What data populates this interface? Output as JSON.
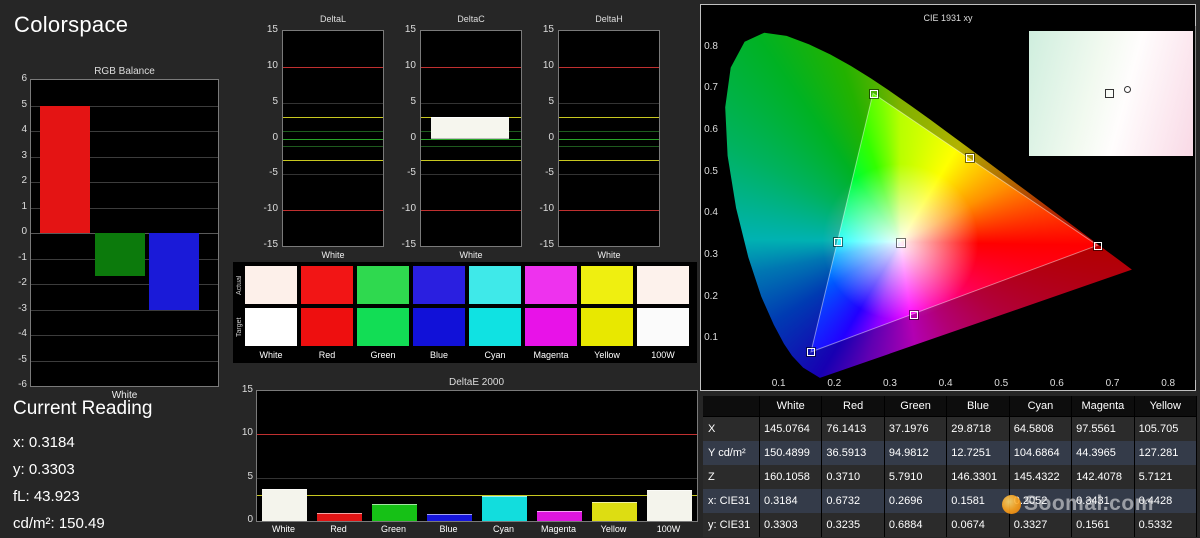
{
  "app": {
    "title": "Colorspace"
  },
  "current_reading": {
    "heading": "Current Reading",
    "lines": [
      {
        "label": "x:",
        "value": "0.3184"
      },
      {
        "label": "y:",
        "value": "0.3303"
      },
      {
        "label": "fL:",
        "value": "43.923"
      },
      {
        "label": "cd/m²:",
        "value": "150.49"
      }
    ]
  },
  "watermark": {
    "text": "Soomal.com"
  },
  "swatches": {
    "row_labels": [
      "Actual",
      "Target"
    ],
    "columns": [
      "White",
      "Red",
      "Green",
      "Blue",
      "Cyan",
      "Magenta",
      "Yellow",
      "100W"
    ],
    "actual_colors": [
      "#fdf0ea",
      "#f21515",
      "#2fd94f",
      "#2a1fe0",
      "#3fe9e9",
      "#ee32ee",
      "#efef10",
      "#fdf2ec"
    ],
    "target_colors": [
      "#ffffff",
      "#ee0f0f",
      "#12dd55",
      "#1111d8",
      "#10e2e2",
      "#e812e8",
      "#e8e800",
      "#fbfbfb"
    ]
  },
  "chart_data": [
    {
      "id": "rgb_balance",
      "type": "bar",
      "title": "RGB Balance",
      "xlabel": "White",
      "categories": [
        "Red",
        "Green",
        "Blue"
      ],
      "values": [
        5.0,
        -1.7,
        -3.0
      ],
      "colors": [
        "#e41414",
        "#0c7a0c",
        "#1a1ad8"
      ],
      "ylim": [
        -6,
        6
      ],
      "yticks": [
        6,
        5,
        4,
        3,
        2,
        1,
        0,
        -1,
        -2,
        -3,
        -4,
        -5,
        -6
      ]
    },
    {
      "id": "deltaL",
      "type": "bar",
      "title": "DeltaL",
      "xlabel": "White",
      "categories": [
        "White"
      ],
      "values": [
        0
      ],
      "ylim": [
        -15,
        15
      ],
      "yticks": [
        15,
        10,
        5,
        0,
        -5,
        -10,
        -15
      ],
      "ref_lines": [
        {
          "y": 10,
          "color": "#c03030"
        },
        {
          "y": -10,
          "color": "#c03030"
        },
        {
          "y": 3,
          "color": "#c8c820"
        },
        {
          "y": -3,
          "color": "#c8c820"
        },
        {
          "y": 1,
          "color": "#1e5a1e"
        },
        {
          "y": -1,
          "color": "#1e5a1e"
        },
        {
          "y": 0,
          "color": "#28a428"
        }
      ]
    },
    {
      "id": "deltaC",
      "type": "bar",
      "title": "DeltaC",
      "xlabel": "White",
      "categories": [
        "White"
      ],
      "values": [
        3.0
      ],
      "ylim": [
        -15,
        15
      ],
      "yticks": [
        15,
        10,
        5,
        0,
        -5,
        -10,
        -15
      ],
      "ref_lines": [
        {
          "y": 10,
          "color": "#c03030"
        },
        {
          "y": -10,
          "color": "#c03030"
        },
        {
          "y": 3,
          "color": "#c8c820"
        },
        {
          "y": -3,
          "color": "#c8c820"
        },
        {
          "y": 1,
          "color": "#1e5a1e"
        },
        {
          "y": -1,
          "color": "#1e5a1e"
        },
        {
          "y": 0,
          "color": "#28a428"
        }
      ]
    },
    {
      "id": "deltaH",
      "type": "bar",
      "title": "DeltaH",
      "xlabel": "White",
      "categories": [
        "White"
      ],
      "values": [
        0
      ],
      "ylim": [
        -15,
        15
      ],
      "yticks": [
        15,
        10,
        5,
        0,
        -5,
        -10,
        -15
      ],
      "ref_lines": [
        {
          "y": 10,
          "color": "#c03030"
        },
        {
          "y": -10,
          "color": "#c03030"
        },
        {
          "y": 3,
          "color": "#c8c820"
        },
        {
          "y": -3,
          "color": "#c8c820"
        },
        {
          "y": 1,
          "color": "#1e5a1e"
        },
        {
          "y": -1,
          "color": "#1e5a1e"
        },
        {
          "y": 0,
          "color": "#28a428"
        }
      ]
    },
    {
      "id": "deltae2000",
      "type": "bar",
      "title": "DeltaE 2000",
      "categories": [
        "White",
        "Red",
        "Green",
        "Blue",
        "Cyan",
        "Magenta",
        "Yellow",
        "100W"
      ],
      "values": [
        3.7,
        0.9,
        2.0,
        0.8,
        2.9,
        1.2,
        2.2,
        3.6
      ],
      "colors": [
        "#f4f4ec",
        "#e01414",
        "#16c116",
        "#1616dd",
        "#12dddd",
        "#dd16dd",
        "#dddd12",
        "#f4f4ec"
      ],
      "ylim": [
        0,
        15
      ],
      "yticks": [
        15,
        10,
        5,
        0
      ],
      "ref_lines": [
        {
          "y": 10,
          "color": "#c03030"
        },
        {
          "y": 3,
          "color": "#c8c820"
        }
      ]
    },
    {
      "id": "cie1931",
      "type": "scatter",
      "title": "CIE 1931 xy",
      "xlim": [
        0,
        0.85
      ],
      "ylim": [
        0,
        0.85
      ],
      "xticks": [
        0.1,
        0.2,
        0.3,
        0.4,
        0.5,
        0.6,
        0.7,
        0.8
      ],
      "yticks": [
        0.1,
        0.2,
        0.3,
        0.4,
        0.5,
        0.6,
        0.7,
        0.8
      ],
      "points": [
        {
          "name": "White",
          "x": 0.3184,
          "y": 0.3303
        },
        {
          "name": "Red",
          "x": 0.6732,
          "y": 0.3235
        },
        {
          "name": "Green",
          "x": 0.2696,
          "y": 0.6884
        },
        {
          "name": "Blue",
          "x": 0.1581,
          "y": 0.0674
        },
        {
          "name": "Cyan",
          "x": 0.2052,
          "y": 0.3327
        },
        {
          "name": "Magenta",
          "x": 0.3431,
          "y": 0.1561
        },
        {
          "name": "Yellow",
          "x": 0.4428,
          "y": 0.5332
        }
      ],
      "gamut_triangle": [
        {
          "x": 0.6732,
          "y": 0.3235
        },
        {
          "x": 0.2696,
          "y": 0.6884
        },
        {
          "x": 0.1581,
          "y": 0.0674
        }
      ]
    },
    {
      "id": "measurements",
      "type": "table",
      "columns": [
        "",
        "White",
        "Red",
        "Green",
        "Blue",
        "Cyan",
        "Magenta",
        "Yellow"
      ],
      "rows": [
        {
          "label": "X",
          "values": [
            "145.0764",
            "76.1413",
            "37.1976",
            "29.8718",
            "64.5808",
            "97.5561",
            "105.705"
          ]
        },
        {
          "label": "Y cd/m²",
          "values": [
            "150.4899",
            "36.5913",
            "94.9812",
            "12.7251",
            "104.6864",
            "44.3965",
            "127.281"
          ]
        },
        {
          "label": "Z",
          "values": [
            "160.1058",
            "0.3710",
            "5.7910",
            "146.3301",
            "145.4322",
            "142.4078",
            "5.7121"
          ]
        },
        {
          "label": "x: CIE31",
          "values": [
            "0.3184",
            "0.6732",
            "0.2696",
            "0.1581",
            "0.2052",
            "0.3431",
            "0.4428"
          ]
        },
        {
          "label": "y: CIE31",
          "values": [
            "0.3303",
            "0.3235",
            "0.6884",
            "0.0674",
            "0.3327",
            "0.1561",
            "0.5332"
          ]
        }
      ]
    }
  ]
}
